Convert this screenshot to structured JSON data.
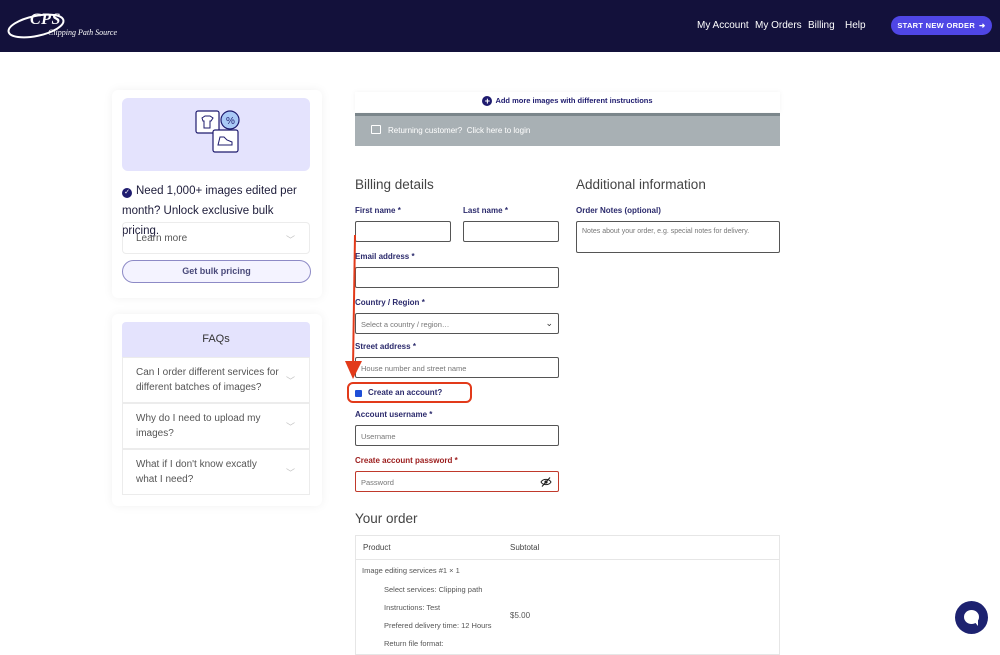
{
  "header": {
    "logo_text": "CPS",
    "logo_subtitle": "Clipping Path Source",
    "nav": [
      "My Account",
      "My Orders",
      "Billing",
      "Help"
    ],
    "cta_label": "START NEW ORDER",
    "cta_icon": "arrow-right-icon"
  },
  "promo": {
    "text": "Need 1,000+ images edited per month? Unlock exclusive bulk pricing.",
    "learn_more": "Learn more",
    "bulk_button": "Get bulk pricing"
  },
  "faq": {
    "title": "FAQs",
    "items": [
      "Can I order different services for different batches of images?",
      "Why do I need to upload my images?",
      "What if I don't know excatly what I need?"
    ]
  },
  "checkout": {
    "add_more": "Add more images with different instructions",
    "returning_text": "Returning customer?",
    "returning_link": "Click here to login",
    "billing_title": "Billing details",
    "additional_title": "Additional information",
    "first_name_label": "First name",
    "last_name_label": "Last name",
    "email_label": "Email address",
    "country_label": "Country / Region",
    "country_placeholder": "Select a country / region…",
    "street_label": "Street address",
    "street_placeholder": "House number and street name",
    "create_account_label": "Create an account?",
    "username_label": "Account username",
    "username_placeholder": "Username",
    "password_label": "Create account password",
    "password_placeholder": "Password",
    "required_mark": "*",
    "order_notes_label": "Order Notes (optional)",
    "order_notes_placeholder": "Notes about your order, e.g. special notes for delivery."
  },
  "order": {
    "title": "Your order",
    "col_product": "Product",
    "col_subtotal": "Subtotal",
    "item_name": "Image editing services #1",
    "item_qty": "× 1",
    "item_price": "$5.00",
    "details": [
      "Select services:  Clipping path",
      "Instructions:  Test",
      "Prefered delivery time:  12 Hours",
      "Return file format:"
    ]
  },
  "colors": {
    "header_bg": "#13113b",
    "accent": "#4f46e5",
    "highlight": "#e23a1a"
  }
}
